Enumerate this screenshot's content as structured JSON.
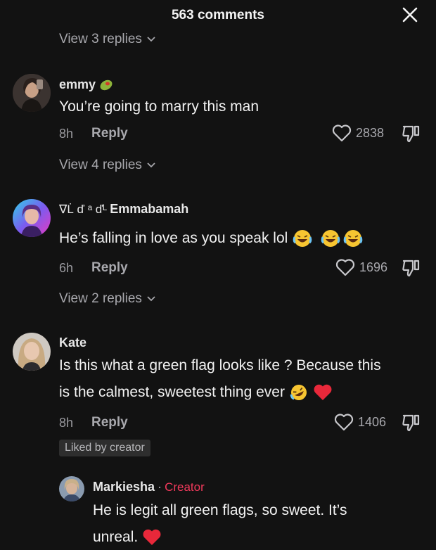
{
  "header": {
    "title": "563 comments"
  },
  "top_view_replies": "View 3 replies",
  "comments": [
    {
      "username": "emmy",
      "text": "You’re going to marry this man",
      "time": "8h",
      "reply_label": "Reply",
      "likes": "2838",
      "view_replies": "View 4 replies"
    },
    {
      "username_prefix": "∇L̇ ď ᵃ ďᴸ",
      "username": "Emmabamah",
      "text": "He’s falling in love as you speak lol",
      "time": "6h",
      "reply_label": "Reply",
      "likes": "1696",
      "view_replies": "View 2 replies"
    },
    {
      "username": "Kate",
      "text_line1": "Is this what a green flag looks like ? Because this",
      "text_line2": "is the calmest, sweetest thing ever",
      "time": "8h",
      "reply_label": "Reply",
      "likes": "1406",
      "badge": "Liked by creator"
    }
  ],
  "reply": {
    "username": "Markiesha",
    "separator": "·",
    "creator_label": "Creator",
    "text_line1": "He is legit all green flags, so sweet. It’s",
    "text_line2": "unreal."
  },
  "colors": {
    "background": "#121212",
    "creator": "#f23a5c",
    "muted": "#a8a8ad"
  },
  "icons": [
    "close-icon",
    "chevron-down-icon",
    "heart-outline-icon",
    "thumbs-down-icon",
    "laughing-emoji",
    "rofl-emoji",
    "red-heart-emoji",
    "olive-emoji"
  ]
}
